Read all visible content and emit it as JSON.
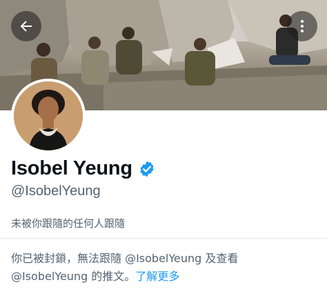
{
  "header": {
    "back_icon": "arrow-left-icon",
    "more_icon": "more-vertical-icon"
  },
  "profile": {
    "display_name": "Isobel Yeung",
    "verified_icon": "verified-badge-icon",
    "verified_color": "#1d9bf0",
    "handle": "@IsobelYeung",
    "followers_you_know": "未被你跟隨的任何人跟隨"
  },
  "blocked_notice": {
    "line1": "你已被封鎖，無法跟隨 @IsobelYeung 及查看",
    "line2": "@IsobelYeung 的推文。",
    "learn_more": "了解更多",
    "link_color": "#1d9bf0"
  }
}
